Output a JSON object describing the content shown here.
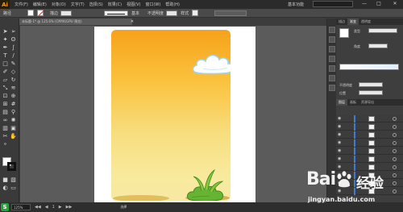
{
  "menubar": {
    "app_logo": "Ai",
    "menus": [
      "文件(F)",
      "编辑(E)",
      "对象(O)",
      "文字(T)",
      "选择(S)",
      "效果(C)",
      "视图(V)",
      "窗口(W)",
      "帮助(H)"
    ],
    "workspace": "基本功能",
    "window_buttons": [
      "—",
      "□",
      "✕"
    ]
  },
  "controlbar": {
    "selection_label": "路径",
    "stroke_label": "描边",
    "uniform_label": "等比",
    "basic_label": "基本",
    "opacity_label": "不透明度",
    "style_label": "样式"
  },
  "document": {
    "tab_title": "未标题-1* @ 125.6% (CMYK/GPU 预览)",
    "close_glyph": "✕"
  },
  "statusbar": {
    "zoom": "125%",
    "nav": [
      "◀◀",
      "◀",
      "1",
      "▶",
      "▶▶"
    ],
    "status_text": "选择"
  },
  "right_panel": {
    "top_tabs": [
      "描边",
      "渐变",
      "透明度"
    ],
    "gradient_type_label": "类型",
    "angle_label": "角度",
    "opacity_label": "不透明度",
    "location_label": "位置",
    "layers_tabs": [
      "图层",
      "画板",
      "资源导出"
    ]
  },
  "layers": {
    "rows": 10
  },
  "watermark": {
    "brand": "Bai",
    "brand_suffix": "经验",
    "url": "jingyan.baidu.com"
  },
  "colors": {
    "accent": "#f39c1d",
    "sky_top": "#f6a21a",
    "sky_bottom": "#f7e8a4",
    "grass": "#5fae2f",
    "layer_highlight": "#3d7bd9"
  },
  "icons": {
    "tools": [
      "selection-tool-icon",
      "direct-selection-tool-icon",
      "magic-wand-icon",
      "lasso-icon",
      "pen-tool-icon",
      "curvature-tool-icon",
      "type-tool-icon",
      "line-tool-icon",
      "rectangle-tool-icon",
      "paintbrush-icon",
      "pencil-icon",
      "shaper-icon",
      "eraser-icon",
      "rotate-icon",
      "scale-icon",
      "width-tool-icon",
      "free-transform-icon",
      "shape-builder-icon",
      "perspective-grid-icon",
      "mesh-icon",
      "gradient-tool-icon",
      "eyedropper-icon",
      "blend-tool-icon",
      "symbol-sprayer-icon",
      "column-graph-icon",
      "artboard-tool-icon",
      "slice-tool-icon",
      "hand-tool-icon",
      "zoom-tool-icon"
    ]
  }
}
